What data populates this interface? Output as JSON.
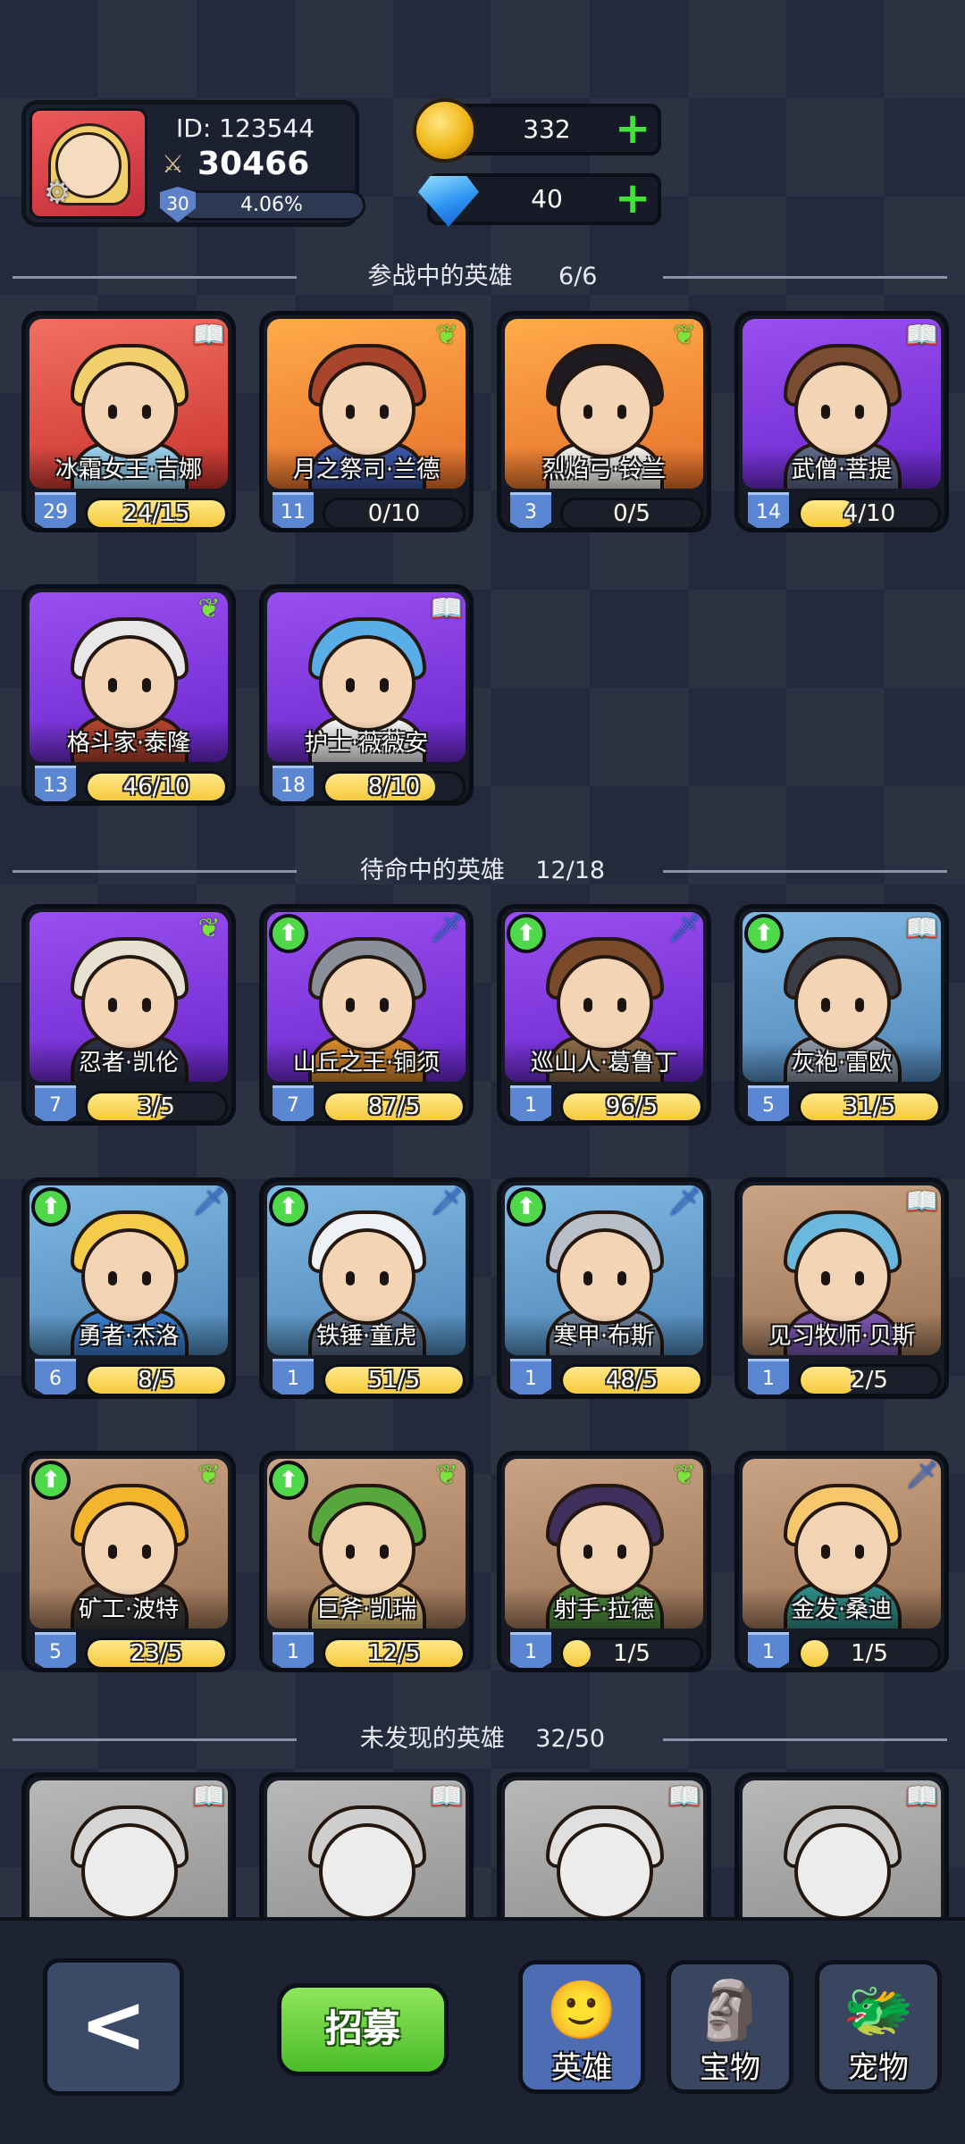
{
  "profile": {
    "id_label": "ID: 123544",
    "power": "30466",
    "level": "30",
    "exp_percent": "4.06%"
  },
  "currency": {
    "gold": "332",
    "gems": "40",
    "plus": "+"
  },
  "sections": {
    "active": {
      "title": "参战中的英雄",
      "count": "6/6"
    },
    "standby": {
      "title": "待命中的英雄",
      "count": "12/18"
    },
    "undiscovered": {
      "title": "未发现的英雄",
      "count": "32/50"
    }
  },
  "active_heroes": [
    {
      "name": "冰霜女王·吉娜",
      "level": "29",
      "shards": "24/15",
      "progress": 1.0,
      "tag": "book-icon"
    },
    {
      "name": "月之祭司·兰德",
      "level": "11",
      "shards": "0/10",
      "progress": 0.0,
      "tag": "leaf-icon"
    },
    {
      "name": "烈焰弓·铃兰",
      "level": "3",
      "shards": "0/5",
      "progress": 0.0,
      "tag": "leaf-icon"
    },
    {
      "name": "武僧·菩提",
      "level": "14",
      "shards": "4/10",
      "progress": 0.4,
      "tag": "book-icon"
    },
    {
      "name": "格斗家·泰隆",
      "level": "13",
      "shards": "46/10",
      "progress": 1.0,
      "tag": "leaf-icon"
    },
    {
      "name": "护士·薇薇安",
      "level": "18",
      "shards": "8/10",
      "progress": 0.8,
      "tag": "book-icon"
    }
  ],
  "standby_heroes": [
    {
      "name": "忍者·凯伦",
      "level": "7",
      "shards": "3/5",
      "progress": 0.6,
      "tag": "leaf-icon",
      "upgradable": false
    },
    {
      "name": "山丘之王·铜须",
      "level": "7",
      "shards": "87/5",
      "progress": 1.0,
      "tag": "sword-icon",
      "upgradable": true
    },
    {
      "name": "巡山人·葛鲁丁",
      "level": "1",
      "shards": "96/5",
      "progress": 1.0,
      "tag": "sword-icon",
      "upgradable": true
    },
    {
      "name": "灰袍·雷欧",
      "level": "5",
      "shards": "31/5",
      "progress": 1.0,
      "tag": "book-icon",
      "upgradable": true
    },
    {
      "name": "勇者·杰洛",
      "level": "6",
      "shards": "8/5",
      "progress": 1.0,
      "tag": "sword-icon",
      "upgradable": true
    },
    {
      "name": "铁锤·童虎",
      "level": "1",
      "shards": "51/5",
      "progress": 1.0,
      "tag": "sword-icon",
      "upgradable": true
    },
    {
      "name": "寒甲·布斯",
      "level": "1",
      "shards": "48/5",
      "progress": 1.0,
      "tag": "sword-icon",
      "upgradable": true
    },
    {
      "name": "见习牧师·贝斯",
      "level": "1",
      "shards": "2/5",
      "progress": 0.4,
      "tag": "book-icon",
      "upgradable": false
    },
    {
      "name": "矿工·波特",
      "level": "5",
      "shards": "23/5",
      "progress": 1.0,
      "tag": "leaf-icon",
      "upgradable": true
    },
    {
      "name": "巨斧·凯瑞",
      "level": "1",
      "shards": "12/5",
      "progress": 1.0,
      "tag": "leaf-icon",
      "upgradable": true
    },
    {
      "name": "射手·拉德",
      "level": "1",
      "shards": "1/5",
      "progress": 0.2,
      "tag": "leaf-icon",
      "upgradable": false
    },
    {
      "name": "金发·桑迪",
      "level": "1",
      "shards": "1/5",
      "progress": 0.2,
      "tag": "sword-icon",
      "upgradable": false
    }
  ],
  "nav": {
    "back": "<",
    "recruit": "招募",
    "heroes": "英雄",
    "treasure": "宝物",
    "pets": "宠物"
  }
}
